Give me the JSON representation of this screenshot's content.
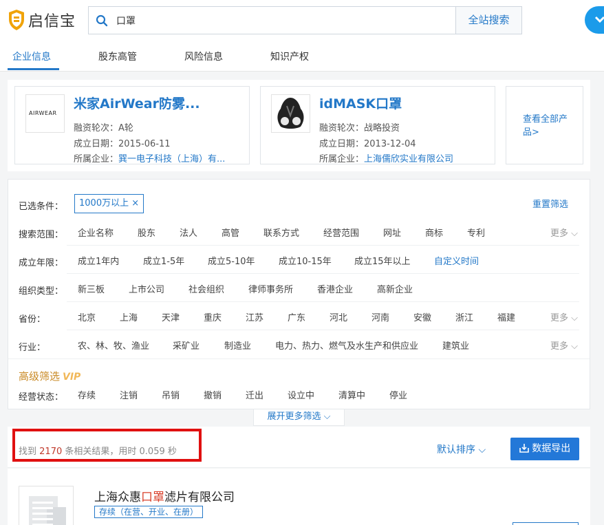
{
  "brand": {
    "name": "启信宝"
  },
  "search": {
    "value": "口罩",
    "button": "全站搜索"
  },
  "tabs": [
    "企业信息",
    "股东高管",
    "风险信息",
    "知识产权"
  ],
  "products": [
    {
      "logo_text": "AIRWEAR",
      "title": "米家AirWear防雾...",
      "funding_label": "融资轮次：",
      "funding": "A轮",
      "date_label": "成立日期：",
      "date": "2015-06-11",
      "company_label": "所属企业：",
      "company": "巽一电子科技（上海）有..."
    },
    {
      "title": "idMASK口罩",
      "funding_label": "融资轮次：",
      "funding": "战略投资",
      "date_label": "成立日期：",
      "date": "2013-12-04",
      "company_label": "所属企业：",
      "company": "上海儒欣实业有限公司"
    }
  ],
  "view_all": "查看全部产品>",
  "filters": {
    "selected_label": "已选条件：",
    "selected_chip": "1000万以上 ×",
    "reset": "重置筛选",
    "more": "更多",
    "scope": {
      "label": "搜索范围：",
      "options": [
        "企业名称",
        "股东",
        "法人",
        "高管",
        "联系方式",
        "经营范围",
        "网址",
        "商标",
        "专利"
      ]
    },
    "years": {
      "label": "成立年限：",
      "options": [
        "成立1年内",
        "成立1-5年",
        "成立5-10年",
        "成立10-15年",
        "成立15年以上"
      ],
      "custom": "自定义时间"
    },
    "org": {
      "label": "组织类型：",
      "options": [
        "新三板",
        "上市公司",
        "社会组织",
        "律师事务所",
        "香港企业",
        "高新企业"
      ]
    },
    "province": {
      "label": "省份：",
      "options": [
        "北京",
        "上海",
        "天津",
        "重庆",
        "江苏",
        "广东",
        "河北",
        "河南",
        "安徽",
        "浙江",
        "福建"
      ]
    },
    "industry": {
      "label": "行业：",
      "options": [
        "农、林、牧、渔业",
        "采矿业",
        "制造业",
        "电力、热力、燃气及水生产和供应业",
        "建筑业"
      ]
    },
    "advanced_title": "高级筛选",
    "vip": "VIP",
    "status": {
      "label": "经营状态：",
      "options": [
        "存续",
        "注销",
        "吊销",
        "撤销",
        "迁出",
        "设立中",
        "清算中",
        "停业"
      ]
    },
    "expand": "展开更多筛选"
  },
  "results": {
    "prefix": "找到",
    "count": "2170",
    "suffix": "条相关结果，用时 0.059 秒",
    "sort": "默认排序",
    "export": "数据导出"
  },
  "company": {
    "name_pre": "上海众惠",
    "name_hl": "口罩",
    "name_post": "滤片有限公司",
    "status": "存续（在营、开业、在册）"
  },
  "colors": {
    "brand": "#2378c8",
    "highlight": "#e01010",
    "advanced": "#c98a26"
  }
}
